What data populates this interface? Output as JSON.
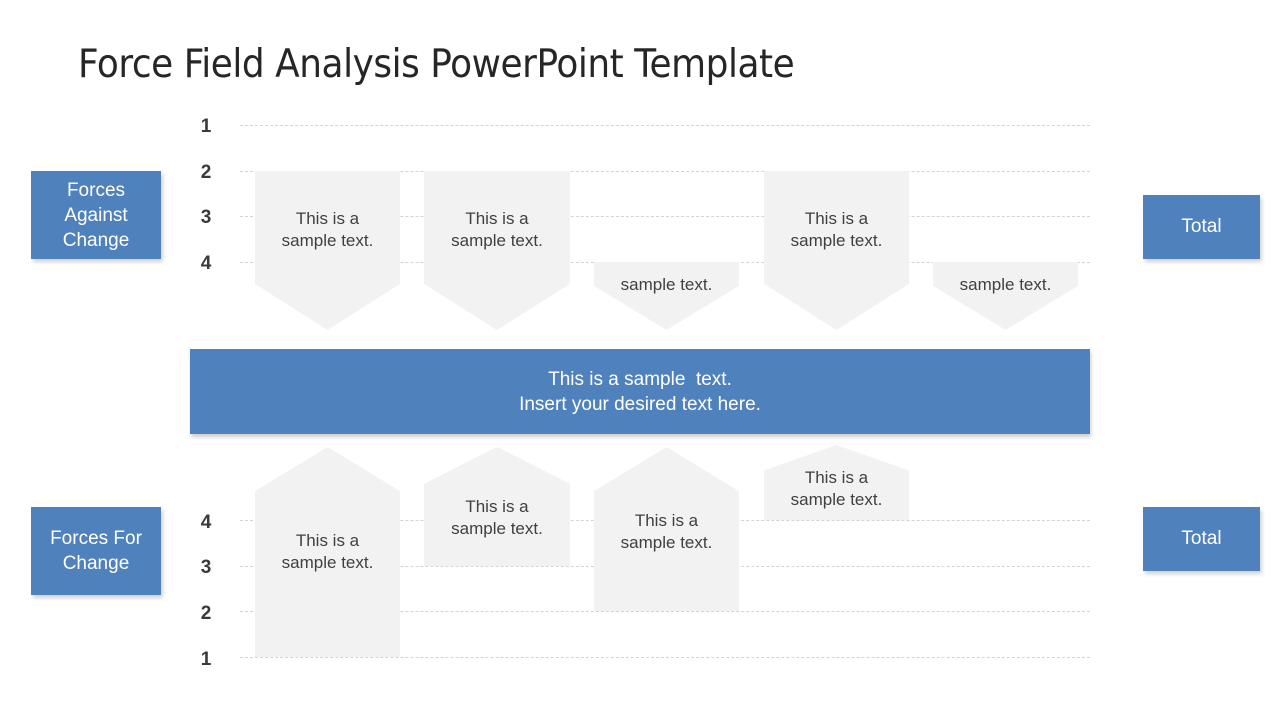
{
  "title": "Force Field Analysis PowerPoint Template",
  "colors": {
    "accent": "#4f81bd",
    "arrow_fill": "#f2f2f2",
    "text_dark": "#404040"
  },
  "forces_against": {
    "label": "Forces\nAgainst\nChange",
    "total_label": "Total",
    "scale_ticks": [
      "1",
      "2",
      "3",
      "4"
    ],
    "arrows": [
      {
        "text": "This is a\nsample text.",
        "strength": 3
      },
      {
        "text": "This is a\nsample text.",
        "strength": 3
      },
      {
        "text": "sample text.",
        "strength": 1
      },
      {
        "text": "This is a\nsample text.",
        "strength": 3
      },
      {
        "text": "sample text.",
        "strength": 1
      }
    ]
  },
  "center": {
    "line1": "This is a sample  text.",
    "line2": "Insert your desired text here."
  },
  "forces_for": {
    "label": "Forces  For\nChange",
    "total_label": "Total",
    "scale_ticks": [
      "4",
      "3",
      "2",
      "1"
    ],
    "arrows": [
      {
        "text": "This is a\nsample text.",
        "strength": 4
      },
      {
        "text": "This is a\nsample text.",
        "strength": 2
      },
      {
        "text": "This is a\nsample text.",
        "strength": 3
      },
      {
        "text": "This is a\nsample text.",
        "strength": 1
      }
    ]
  }
}
